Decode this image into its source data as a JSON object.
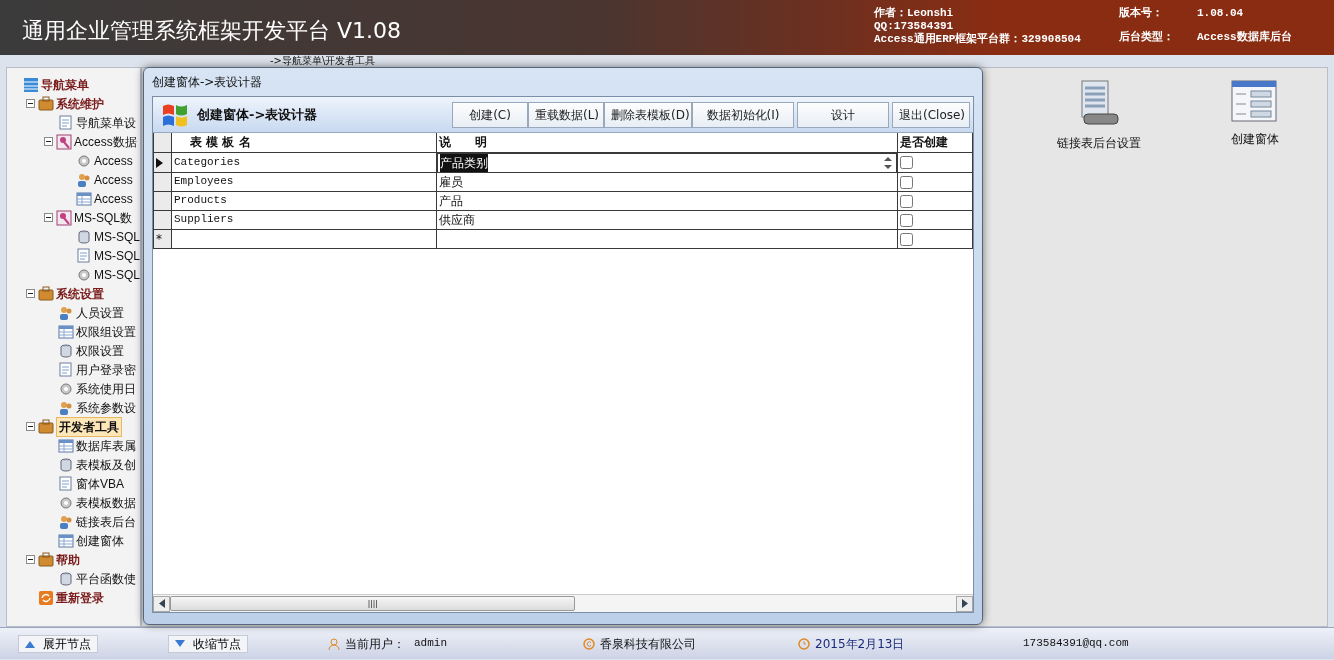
{
  "app": {
    "title": "通用企业管理系统框架开发平台 V1.08",
    "author": "作者：Leonshi",
    "qq": "QQ:173584391",
    "group": "Access通用ERP框架平台群：329908504",
    "version_label": "版本号：",
    "version": "1.08.04",
    "backend_label": "后台类型：",
    "backend": "Access数据库后台"
  },
  "breadcrumb": "->导航菜单\\开发者工具",
  "nav_tree": {
    "title": "导航菜单",
    "items": [
      {
        "label": "系统维护",
        "expanded": true,
        "selected": false,
        "children": [
          {
            "label": "导航菜单设"
          },
          {
            "label": "Access数据",
            "expanded": true,
            "children": [
              {
                "label": "Access"
              },
              {
                "label": "Access"
              },
              {
                "label": "Access"
              }
            ]
          },
          {
            "label": "MS-SQL数",
            "expanded": true,
            "children": [
              {
                "label": "MS-SQL"
              },
              {
                "label": "MS-SQL"
              },
              {
                "label": "MS-SQL"
              }
            ]
          }
        ]
      },
      {
        "label": "系统设置",
        "expanded": true,
        "selected": false,
        "children": [
          {
            "label": "人员设置"
          },
          {
            "label": "权限组设置"
          },
          {
            "label": "权限设置"
          },
          {
            "label": "用户登录密"
          },
          {
            "label": "系统使用日"
          },
          {
            "label": "系统参数设"
          }
        ]
      },
      {
        "label": "开发者工具",
        "expanded": true,
        "selected": true,
        "children": [
          {
            "label": "数据库表属"
          },
          {
            "label": "表模板及创"
          },
          {
            "label": "窗体VBA"
          },
          {
            "label": "表模板数据"
          },
          {
            "label": "链接表后台"
          },
          {
            "label": "创建窗体"
          }
        ]
      },
      {
        "label": "帮助",
        "expanded": true,
        "selected": false,
        "children": [
          {
            "label": "平台函数使"
          }
        ]
      },
      {
        "label": "重新登录",
        "selected": false
      }
    ]
  },
  "dialog": {
    "window_title": "创建窗体->表设计器",
    "heading": "创建窗体->表设计器",
    "buttons": [
      "创建(C)",
      "重载数据(L)",
      "删除表模板(D)",
      "数据初始化(I)",
      "设计",
      "退出(Close)"
    ],
    "columns": [
      "表 模 板 名",
      "说　　明",
      "是否创建"
    ],
    "rows": [
      {
        "kind": "data",
        "name": "Categories",
        "description": "产品类别",
        "create": false,
        "current": true,
        "editing": true
      },
      {
        "kind": "data",
        "name": "Employees",
        "description": "雇员",
        "create": false,
        "current": false,
        "editing": false
      },
      {
        "kind": "data",
        "name": "Products",
        "description": "产品",
        "create": false,
        "current": false,
        "editing": false
      },
      {
        "kind": "data",
        "name": "Suppliers",
        "description": "供应商",
        "create": false,
        "current": false,
        "editing": false
      },
      {
        "kind": "new",
        "marker": "*",
        "create": false
      }
    ]
  },
  "shortcuts": [
    {
      "label": "链接表后台设置",
      "kind": "server"
    },
    {
      "label": "创建窗体",
      "kind": "form"
    }
  ],
  "status_bar": {
    "expand": "展开节点",
    "collapse": "收缩节点",
    "user_label": "当前用户：",
    "user": "admin",
    "company": "香泉科技有限公司",
    "date": "2015年2月13日",
    "email": "173584391@qq.com"
  }
}
